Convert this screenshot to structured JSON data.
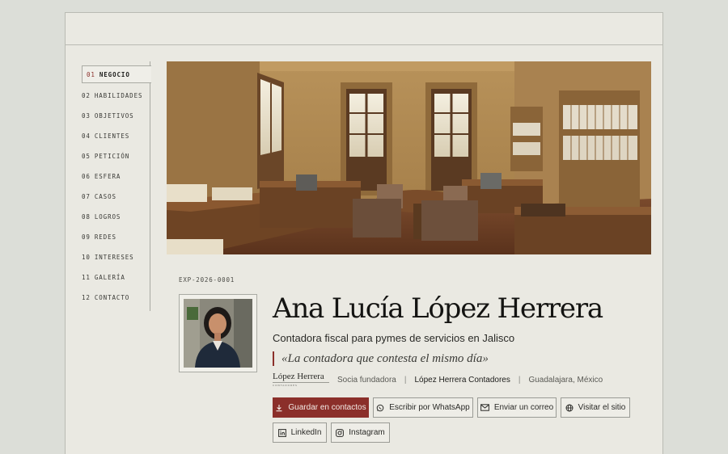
{
  "nav": {
    "items": [
      {
        "num": "01",
        "label": "NEGOCIO"
      },
      {
        "num": "02",
        "label": "HABILIDADES"
      },
      {
        "num": "03",
        "label": "OBJETIVOS"
      },
      {
        "num": "04",
        "label": "CLIENTES"
      },
      {
        "num": "05",
        "label": "PETICIÓN"
      },
      {
        "num": "06",
        "label": "ESFERA"
      },
      {
        "num": "07",
        "label": "CASOS"
      },
      {
        "num": "08",
        "label": "LOGROS"
      },
      {
        "num": "09",
        "label": "REDES"
      },
      {
        "num": "10",
        "label": "INTERESES"
      },
      {
        "num": "11",
        "label": "GALERÍA"
      },
      {
        "num": "12",
        "label": "CONTACTO"
      }
    ],
    "active_index": 0
  },
  "profile": {
    "code": "EXP-2026-0001",
    "name": "Ana Lucía López Herrera",
    "role": "Contadora fiscal para pymes de servicios en Jalisco",
    "tagline": "«La contadora que contesta el mismo día»",
    "logo_name": "López Herrera",
    "logo_sub": "CONTADORES",
    "position": "Socia fundadora",
    "firm": "López Herrera Contadores",
    "location": "Guadalajara, México"
  },
  "actions": {
    "save_contact": "Guardar en contactos",
    "whatsapp": "Escribir por WhatsApp",
    "email": "Enviar un correo",
    "website": "Visitar el sitio",
    "linkedin": "LinkedIn",
    "instagram": "Instagram"
  },
  "colors": {
    "accent": "#8b2f2a",
    "page_bg": "#eae9e2",
    "outer_bg": "#dcded8",
    "text": "#141412"
  },
  "icons": [
    "download-icon",
    "whatsapp-icon",
    "mail-icon",
    "globe-icon",
    "linkedin-icon",
    "instagram-icon"
  ]
}
